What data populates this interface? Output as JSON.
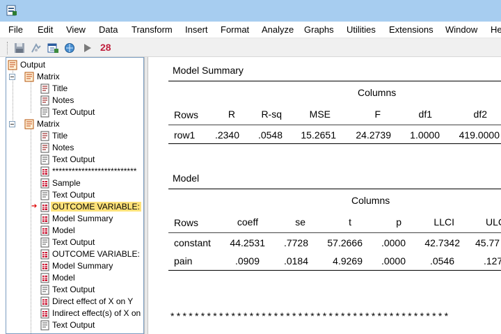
{
  "menu": [
    "File",
    "Edit",
    "View",
    "Data",
    "Transform",
    "Insert",
    "Format",
    "Analyze",
    "Graphs",
    "Utilities",
    "Extensions",
    "Window",
    "He"
  ],
  "toolbar": {
    "buttons": [
      "save-icon",
      "designate-icon",
      "goto-data-icon",
      "goto-variable-icon",
      "run-icon"
    ],
    "badge": "28"
  },
  "outline": {
    "root": "Output",
    "nodes": [
      "Matrix",
      "Title",
      "Notes",
      "Text Output",
      "Matrix",
      "Title",
      "Notes",
      "Text Output",
      "**************************",
      "Sample",
      "Text Output",
      "OUTCOME VARIABLE:",
      "Model Summary",
      "Model",
      "Text Output",
      "OUTCOME VARIABLE:",
      "Model Summary",
      "Model",
      "Text Output",
      "Direct effect of X on Y",
      "Indirect effect(s) of X on",
      "Text Output"
    ]
  },
  "model_summary": {
    "title": "Model Summary",
    "columns_label": "Columns",
    "rows_label": "Rows",
    "headers": [
      "R",
      "R-sq",
      "MSE",
      "F",
      "df1",
      "df2"
    ],
    "rows": [
      {
        "name": "row1",
        "values": [
          ".2340",
          ".0548",
          "15.2651",
          "24.2739",
          "1.0000",
          "419.0000"
        ]
      }
    ]
  },
  "model": {
    "title": "Model",
    "columns_label": "Columns",
    "rows_label": "Rows",
    "headers": [
      "coeff",
      "se",
      "t",
      "p",
      "LLCI",
      "ULC"
    ],
    "rows": [
      {
        "name": "constant",
        "values": [
          "44.2531",
          ".7728",
          "57.2666",
          ".0000",
          "42.7342",
          "45.77"
        ]
      },
      {
        "name": "pain",
        "values": [
          ".0909",
          ".0184",
          "4.9269",
          ".0000",
          ".0546",
          ".127"
        ]
      }
    ]
  },
  "separator": "**********************************************"
}
